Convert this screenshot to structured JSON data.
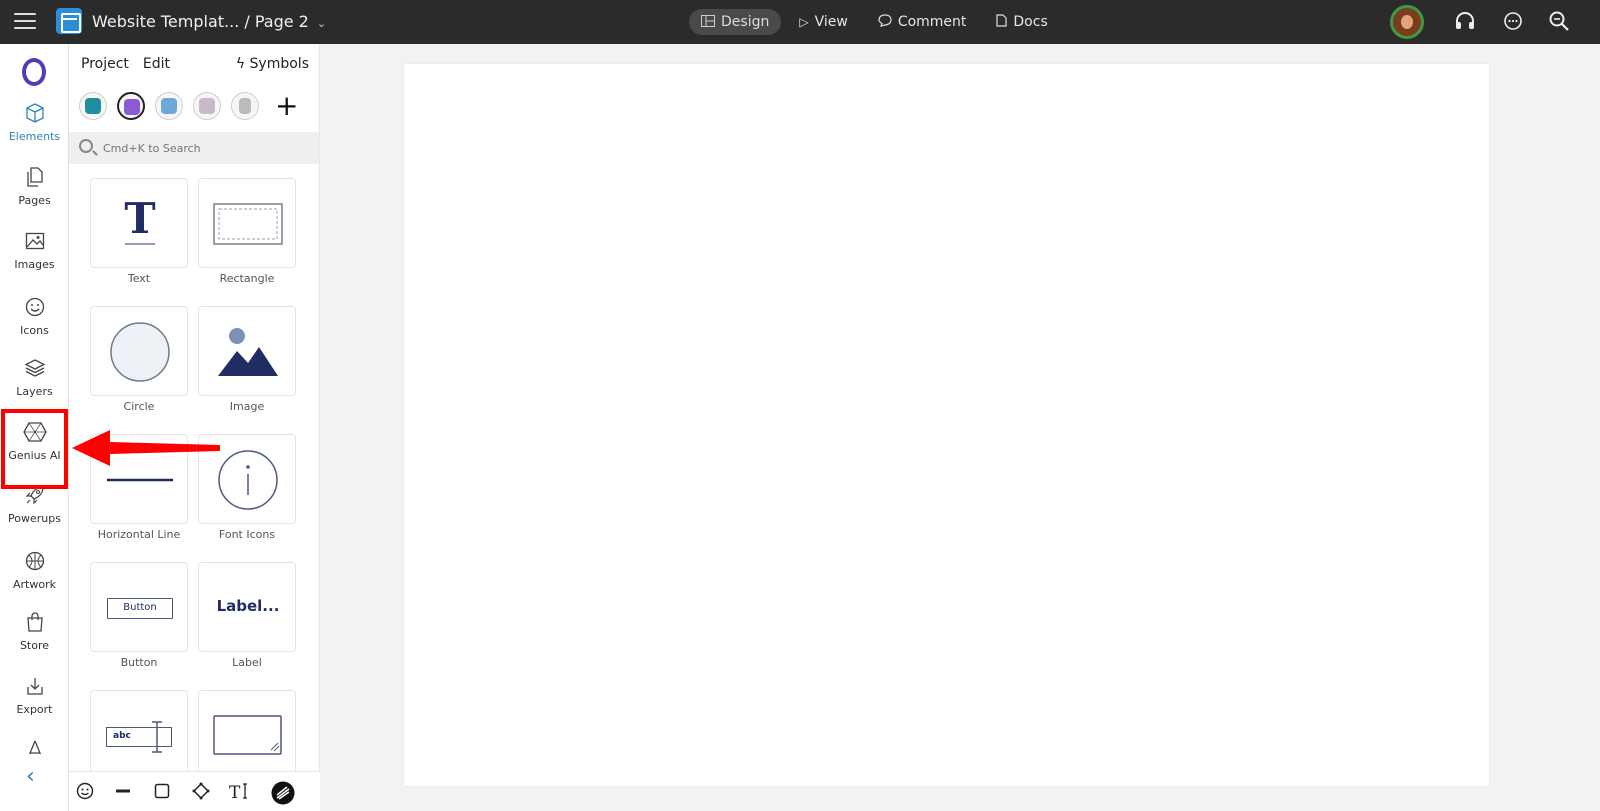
{
  "topbar": {
    "doc_title": "Website Templat... / Page 2",
    "modes": [
      {
        "label": "Design",
        "icon": "layout-icon"
      },
      {
        "label": "View",
        "icon": "play-icon"
      },
      {
        "label": "Comment",
        "icon": "comment-icon"
      },
      {
        "label": "Docs",
        "icon": "doc-icon"
      }
    ],
    "right_icons": [
      "avatar",
      "headphones-icon",
      "chat-icon",
      "zoom-icon"
    ]
  },
  "leftnav": {
    "items": [
      {
        "label": "Elements",
        "icon": "cube-icon"
      },
      {
        "label": "Pages",
        "icon": "pages-icon"
      },
      {
        "label": "Images",
        "icon": "image-icon"
      },
      {
        "label": "Icons",
        "icon": "smiley-icon"
      },
      {
        "label": "Layers",
        "icon": "layers-icon"
      },
      {
        "label": "Genius AI",
        "icon": "genius-hexagon-icon"
      },
      {
        "label": "Powerups",
        "icon": "rocket-icon"
      },
      {
        "label": "Artwork",
        "icon": "ball-icon"
      },
      {
        "label": "Store",
        "icon": "bag-icon"
      },
      {
        "label": "Export",
        "icon": "download-icon"
      }
    ]
  },
  "panel": {
    "menu": [
      "Project",
      "Edit"
    ],
    "symbols_label": "Symbols",
    "search_placeholder": "Cmd+K to Search",
    "elements": [
      {
        "label": "Text"
      },
      {
        "label": "Rectangle"
      },
      {
        "label": "Circle"
      },
      {
        "label": "Image"
      },
      {
        "label": "Horizontal Line"
      },
      {
        "label": "Font Icons"
      },
      {
        "label": "Button",
        "preview_text": "Button"
      },
      {
        "label": "Label",
        "preview_text": "Label..."
      },
      {
        "label": "",
        "preview_text": "abc"
      },
      {
        "label": ""
      }
    ]
  },
  "colors": {
    "accent": "#2d82b6",
    "topbar": "#2b2b2b",
    "annotation": "#ff0000",
    "element_navy": "#1f2d63"
  }
}
